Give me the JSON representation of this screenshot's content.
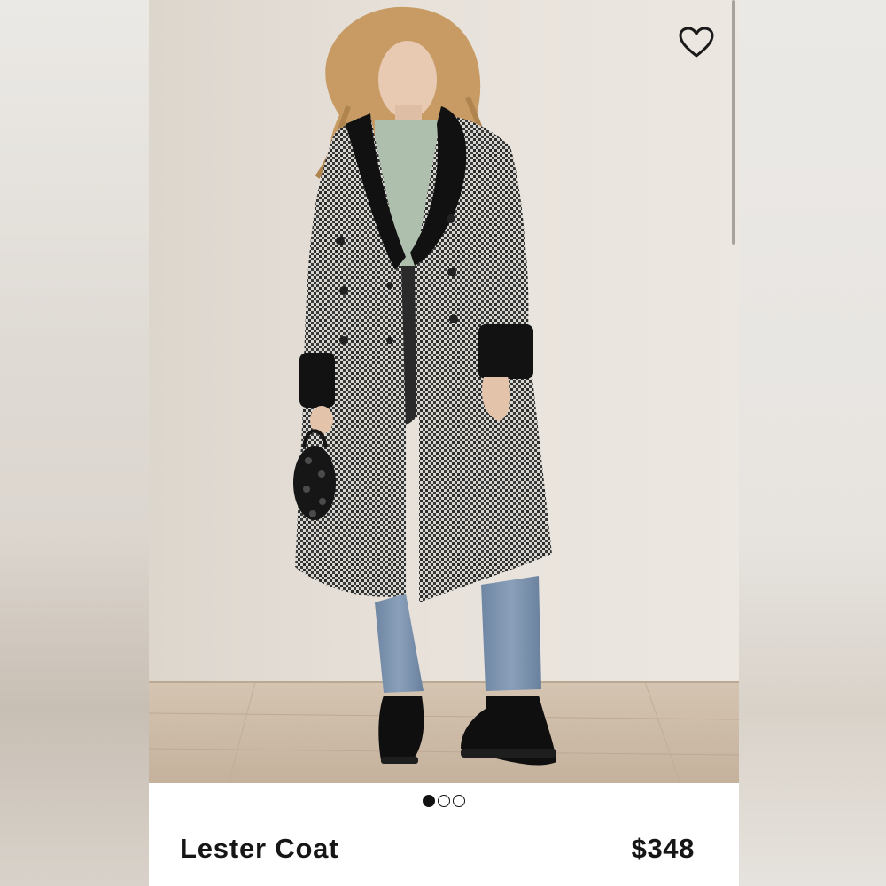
{
  "product": {
    "name": "Lester Coat",
    "price": "$348"
  },
  "gallery": {
    "image_count": 3,
    "active_index": 0
  },
  "icons": {
    "favorite": "heart-outline-icon"
  },
  "colors": {
    "text": "#161616",
    "card_background": "#ffffff",
    "wall": "#e6e0d9",
    "floor": "#c9b8a4"
  }
}
